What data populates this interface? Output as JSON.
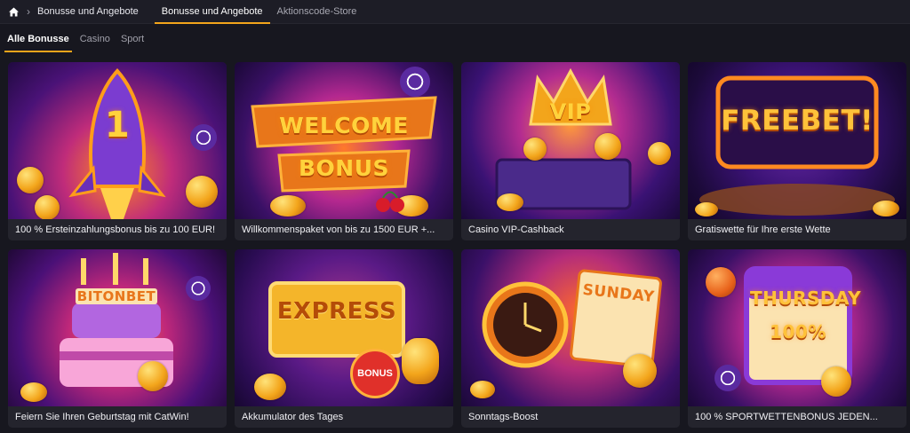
{
  "breadcrumb": {
    "current": "Bonusse und Angebote"
  },
  "top_tabs": [
    {
      "label": "Bonusse und Angebote",
      "active": true
    },
    {
      "label": "Aktionscode-Store",
      "active": false
    }
  ],
  "sub_tabs": [
    {
      "label": "Alle Bonusse",
      "active": true
    },
    {
      "label": "Casino",
      "active": false
    },
    {
      "label": "Sport",
      "active": false
    }
  ],
  "cards": [
    {
      "title": "100 % Ersteinzahlungsbonus bis zu 100 EUR!",
      "art_text": "1"
    },
    {
      "title": "Willkommenspaket von bis zu 1500 EUR +...",
      "art_text": "WELCOME BONUS"
    },
    {
      "title": "Casino VIP-Cashback",
      "art_text": "VIP"
    },
    {
      "title": "Gratiswette für Ihre erste Wette",
      "art_text": "FREEBET!"
    },
    {
      "title": "Feiern Sie Ihren Geburtstag mit CatWin!",
      "art_text": "BITONBET"
    },
    {
      "title": "Akkumulator des Tages",
      "art_text": "EXPRESS"
    },
    {
      "title": "Sonntags-Boost",
      "art_text": "SUNDAY"
    },
    {
      "title": "100 % SPORTWETTENBONUS JEDEN...",
      "art_text": "THURSDAY 100%"
    }
  ],
  "extra_art_text": {
    "bonus_bag": "BONUS"
  },
  "colors": {
    "accent": "#f3a51b",
    "background": "#17171f",
    "card": "#24242d"
  }
}
